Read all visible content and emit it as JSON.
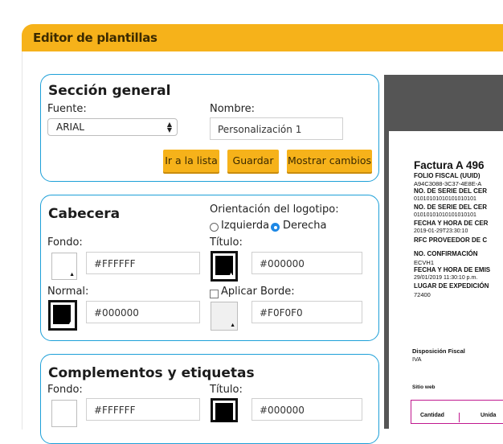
{
  "window": {
    "title": "Editor de plantillas"
  },
  "general": {
    "heading": "Sección general",
    "font_label": "Fuente:",
    "font_value": "ARIAL",
    "name_label": "Nombre:",
    "name_value": "Personalización 1",
    "buttons": {
      "list": "Ir a la lista",
      "save": "Guardar",
      "show": "Mostrar cambios"
    }
  },
  "header": {
    "heading": "Cabecera",
    "logo_orientation_label": "Orientación del logotipo:",
    "orient_left": "Izquierda",
    "orient_right": "Derecha",
    "orient_selected": "Derecha",
    "bg_label": "Fondo:",
    "bg_value": "#FFFFFF",
    "title_label": "Título:",
    "title_value": "#000000",
    "normal_label": "Normal:",
    "normal_value": "#000000",
    "border_label": "Aplicar Borde:",
    "border_value": "#F0F0F0",
    "border_checked": false
  },
  "complements": {
    "heading": "Complementos y etiquetas",
    "bg_label": "Fondo:",
    "bg_value": "#FFFFFF",
    "title_label": "Título:",
    "title_value": "#000000"
  },
  "preview": {
    "lines": [
      "Factura A 496",
      "FOLIO FISCAL (UUID)",
      "A94C3088-3C37-4E8E-A",
      "NO. DE SERIE DEL CER",
      "01010101010101010101",
      "NO. DE SERIE DEL CER",
      "01010101010101010101",
      "FECHA Y HORA DE CER",
      "2019-01-29T23:30:10",
      "RFC PROVEEDOR DE C",
      "NO. CONFIRMACIÓN",
      "ECVH1",
      "FECHA Y HORA DE EMIS",
      "29/01/2019 11:30:10 p.m.",
      "LUGAR DE EXPEDICIÓN",
      "72400",
      "Disposición Fiscal",
      "IVA",
      "Sitio web"
    ],
    "table_headers": [
      "Cantidad",
      "Unida"
    ]
  },
  "colors": {
    "accent": "#f6b21a",
    "card_border": "#1ea0d8",
    "table_border": "#c0188f"
  }
}
